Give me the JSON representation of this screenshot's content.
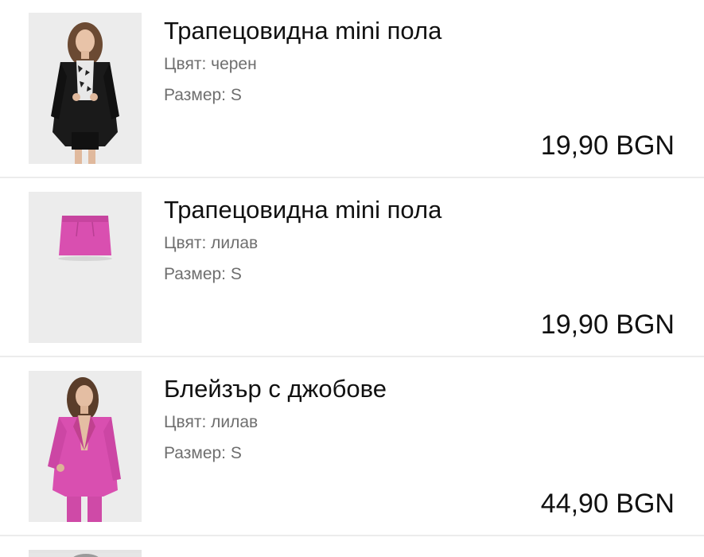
{
  "cart": {
    "items": [
      {
        "title": "Трапецовидна mini пола",
        "color_label": "Цвят:",
        "color_value": "черен",
        "size_label": "Размер:",
        "size_value": "S",
        "price": "19,90 BGN",
        "image": "woman-black-blazer-outfit"
      },
      {
        "title": "Трапецовидна mini пола",
        "color_label": "Цвят:",
        "color_value": "лилав",
        "size_label": "Размер:",
        "size_value": "S",
        "price": "19,90 BGN",
        "image": "pink-mini-skirt"
      },
      {
        "title": "Блейзър с джобове",
        "color_label": "Цвят:",
        "color_value": "лилав",
        "size_label": "Размер:",
        "size_value": "S",
        "price": "44,90 BGN",
        "image": "woman-pink-blazer-suit"
      }
    ]
  },
  "colors": {
    "text": "#111111",
    "secondary_text": "#6e6e6e",
    "divider": "#ececec",
    "thumb_bg": "#ebebeb",
    "pink": "#d94fb0"
  }
}
